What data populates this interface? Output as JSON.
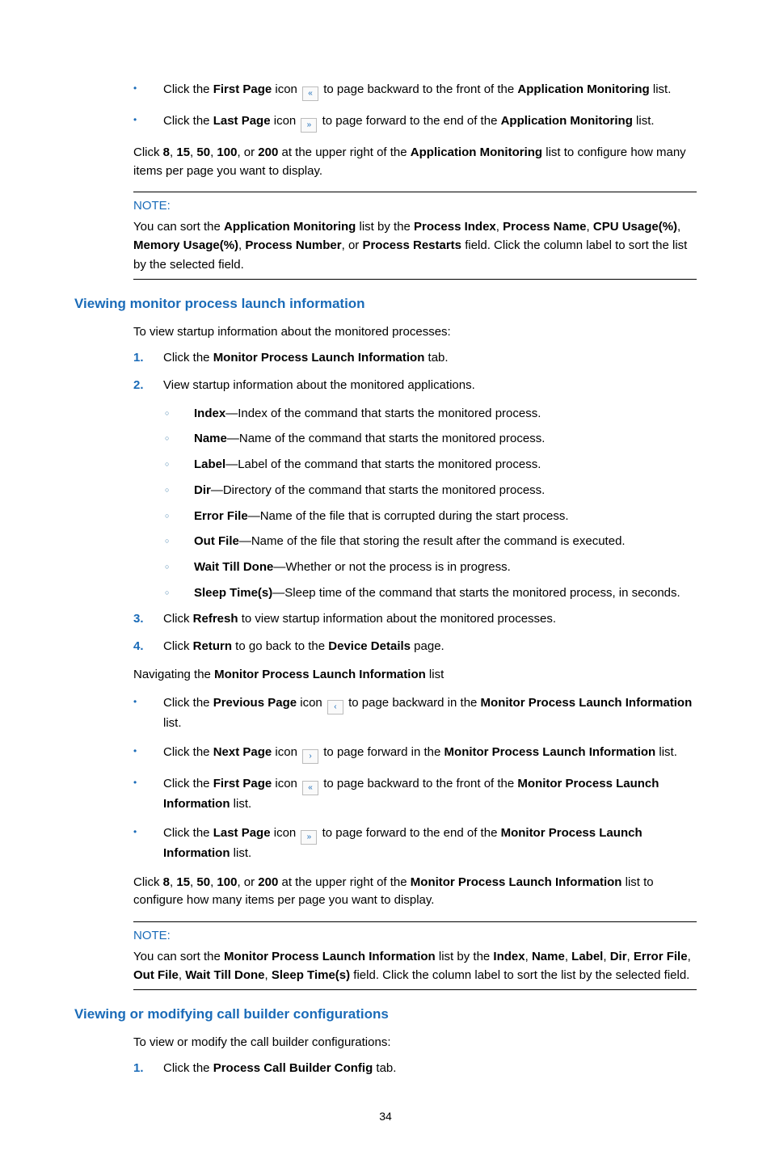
{
  "bullets_top": [
    {
      "pre": "Click the ",
      "b1": "First Page",
      "mid1": " icon ",
      "icon": "«",
      "icon_name": "first-page-icon",
      "mid2": " to page backward to the front of the ",
      "b2": "Application Monitoring",
      "post": " list."
    },
    {
      "pre": "Click the ",
      "b1": "Last Page",
      "mid1": " icon ",
      "icon": "»",
      "icon_name": "last-page-icon",
      "mid2": " to page forward to the end of the ",
      "b2": "Application Monitoring",
      "post": " list."
    }
  ],
  "para_top": {
    "t1": "Click ",
    "b1": "8",
    "t2": ", ",
    "b2": "15",
    "t3": ", ",
    "b3": "50",
    "t4": ", ",
    "b4": "100",
    "t5": ", or ",
    "b5": "200",
    "t6": " at the upper right of the ",
    "b6": "Application Monitoring",
    "t7": " list to configure how many items per page you want to display."
  },
  "note1": {
    "label": "NOTE:",
    "body": {
      "t1": "You can sort the ",
      "b1": "Application Monitoring",
      "t2": " list by the  ",
      "b2": "Process Index",
      "t3": ", ",
      "b3": "Process Name",
      "t4": ", ",
      "b4": "CPU Usage(%)",
      "t5": ", ",
      "b5": "Memory Usage(%)",
      "t6": ", ",
      "b6": "Process Number",
      "t7": ", or ",
      "b7": "Process Restarts",
      "t8": " field. Click the column label to sort the list by the selected field."
    }
  },
  "section1": {
    "heading": "Viewing monitor process launch information",
    "intro": "To view startup information about the monitored processes:",
    "steps": [
      {
        "num": "1.",
        "t1": "Click the ",
        "b1": "Monitor Process Launch Information",
        "t2": " tab."
      },
      {
        "num": "2.",
        "t1": "View startup information about the monitored applications."
      }
    ],
    "fields": [
      {
        "b": "Index",
        "t": "—Index of the command that starts the monitored process."
      },
      {
        "b": "Name",
        "t": "—Name of the command that starts the monitored process."
      },
      {
        "b": "Label",
        "t": "—Label of the command that starts the monitored process."
      },
      {
        "b": "Dir",
        "t": "—Directory of the command that starts the monitored process."
      },
      {
        "b": "Error File",
        "t": "—Name of the file that is corrupted during the start process."
      },
      {
        "b": "Out File",
        "t": "—Name of the file that storing the result after the command is executed."
      },
      {
        "b": "Wait Till Done",
        "t": "—Whether or not the process is in progress."
      },
      {
        "b": "Sleep Time(s)",
        "t": "—Sleep time of the command that starts the monitored process, in seconds."
      }
    ],
    "steps2": [
      {
        "num": "3.",
        "t1": "Click ",
        "b1": "Refresh",
        "t2": " to view startup information about the monitored processes."
      },
      {
        "num": "4.",
        "t1": "Click ",
        "b1": "Return",
        "t2": " to go back to the ",
        "b2": "Device Details",
        "t3": " page."
      }
    ],
    "nav_intro": {
      "t1": "Navigating the ",
      "b1": "Monitor Process Launch Information",
      "t2": " list"
    },
    "nav_bullets": [
      {
        "pre": "Click the ",
        "b1": "Previous Page",
        "mid1": " icon ",
        "icon": "‹",
        "icon_name": "previous-page-icon",
        "mid2": " to page backward in the ",
        "b2": "Monitor Process Launch Information",
        "post": " list."
      },
      {
        "pre": "Click the ",
        "b1": "Next Page",
        "mid1": " icon ",
        "icon": "›",
        "icon_name": "next-page-icon",
        "mid2": " to page forward in the ",
        "b2": "Monitor Process Launch Information",
        "post": " list."
      },
      {
        "pre": "Click the ",
        "b1": "First Page",
        "mid1": " icon ",
        "icon": "«",
        "icon_name": "first-page-icon",
        "mid2": " to page backward to the front of the ",
        "b2": "Monitor Process Launch Information",
        "post": " list."
      },
      {
        "pre": "Click the ",
        "b1": "Last Page",
        "mid1": " icon ",
        "icon": "»",
        "icon_name": "last-page-icon",
        "mid2": " to page forward to the end of the ",
        "b2": "Monitor Process Launch Information",
        "post": " list."
      }
    ],
    "para_bottom": {
      "t1": "Click ",
      "b1": "8",
      "t2": ", ",
      "b2": "15",
      "t3": ", ",
      "b3": "50",
      "t4": ", ",
      "b4": "100",
      "t5": ", or ",
      "b5": "200",
      "t6": " at the upper right of the ",
      "b6": "Monitor Process Launch Information",
      "t7": " list to configure how many items per page you want to display."
    }
  },
  "note2": {
    "label": "NOTE:",
    "body": {
      "t1": "You can sort the ",
      "b1": "Monitor Process Launch Information",
      "t2": " list by the ",
      "b2": "Index",
      "t3": ", ",
      "b3": "Name",
      "t4": ", ",
      "b4": "Label",
      "t5": ", ",
      "b5": "Dir",
      "t6": ", ",
      "b6": "Error File",
      "t7": ", ",
      "b7": "Out File",
      "t8": ", ",
      "b8": "Wait Till Done",
      "t9": ", ",
      "b9": "Sleep Time(s)",
      "t10": " field. Click the column label to sort the list by the selected field."
    }
  },
  "section2": {
    "heading": "Viewing or modifying call builder configurations",
    "intro": "To view or modify the call builder configurations:",
    "steps": [
      {
        "num": "1.",
        "t1": "Click the ",
        "b1": "Process Call Builder Config",
        "t2": " tab."
      }
    ]
  },
  "page_number": "34"
}
